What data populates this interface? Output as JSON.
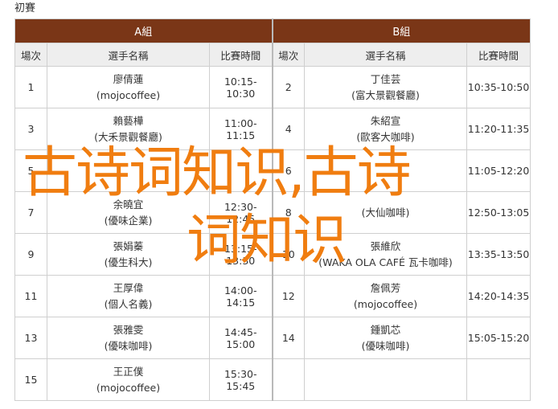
{
  "page": {
    "heading": "初賽"
  },
  "table": {
    "groups": [
      {
        "label": "A組"
      },
      {
        "label": "B組"
      }
    ],
    "columns": {
      "order": "場次",
      "players": "選手名稱",
      "time": "比賽時間"
    },
    "rows": [
      {
        "a_order": "1",
        "a_name": "廖倩蓮",
        "a_team": "(mojocoffee)",
        "a_time": "10:15-10:30",
        "b_order": "2",
        "b_name": "丁佳芸",
        "b_team": "(富大景觀餐廳)",
        "b_time": "10:35-10:50"
      },
      {
        "a_order": "3",
        "a_name": "賴藝樺",
        "a_team": "(大禾景觀餐廳)",
        "a_time": "11:00-11:15",
        "b_order": "4",
        "b_name": "朱紹宣",
        "b_team": "(歐客大咖啡)",
        "b_time": "11:20-11:35"
      },
      {
        "a_order": "5",
        "a_name": "",
        "a_team": "",
        "a_time": "",
        "b_order": "6",
        "b_name": "",
        "b_team": "",
        "b_time": "11:05-12:20"
      },
      {
        "a_order": "7",
        "a_name": "余曉宜",
        "a_team": "(優味企業)",
        "a_time": "12:30-12:45",
        "b_order": "8",
        "b_name": "",
        "b_team": "(大仙咖啡)",
        "b_time": "12:50-13:05"
      },
      {
        "a_order": "9",
        "a_name": "張娟蓁",
        "a_team": "(優生科大)",
        "a_time": "13:15-13:30",
        "b_order": "10",
        "b_name": "張維欣",
        "b_team": "(WAKA OLA CAFÉ 瓦卡咖啡)",
        "b_time": "13:35-13:50"
      },
      {
        "a_order": "11",
        "a_name": "王厚偉",
        "a_team": "(個人名義)",
        "a_time": "14:00-14:15",
        "b_order": "12",
        "b_name": "詹佩芳",
        "b_team": "(mojocoffee)",
        "b_time": "14:20-14:35"
      },
      {
        "a_order": "13",
        "a_name": "張雅雯",
        "a_team": "(優味咖啡)",
        "a_time": "14:45-15:00",
        "b_order": "14",
        "b_name": "鍾凱芯",
        "b_team": "(優味咖啡)",
        "b_time": "15:05-15:20"
      },
      {
        "a_order": "15",
        "a_name": "王正僕",
        "a_team": "(mojocoffee)",
        "a_time": "15:30-15:45",
        "b_order": "",
        "b_name": "",
        "b_team": "",
        "b_time": ""
      }
    ]
  },
  "watermark": {
    "line1": "古诗词知识,古诗",
    "line2": "词知识",
    "color": "#f07d10"
  },
  "colors": {
    "group_header_bg": "#7a3617",
    "column_header_bg": "#eeeeee",
    "border": "#cfcfcf"
  }
}
